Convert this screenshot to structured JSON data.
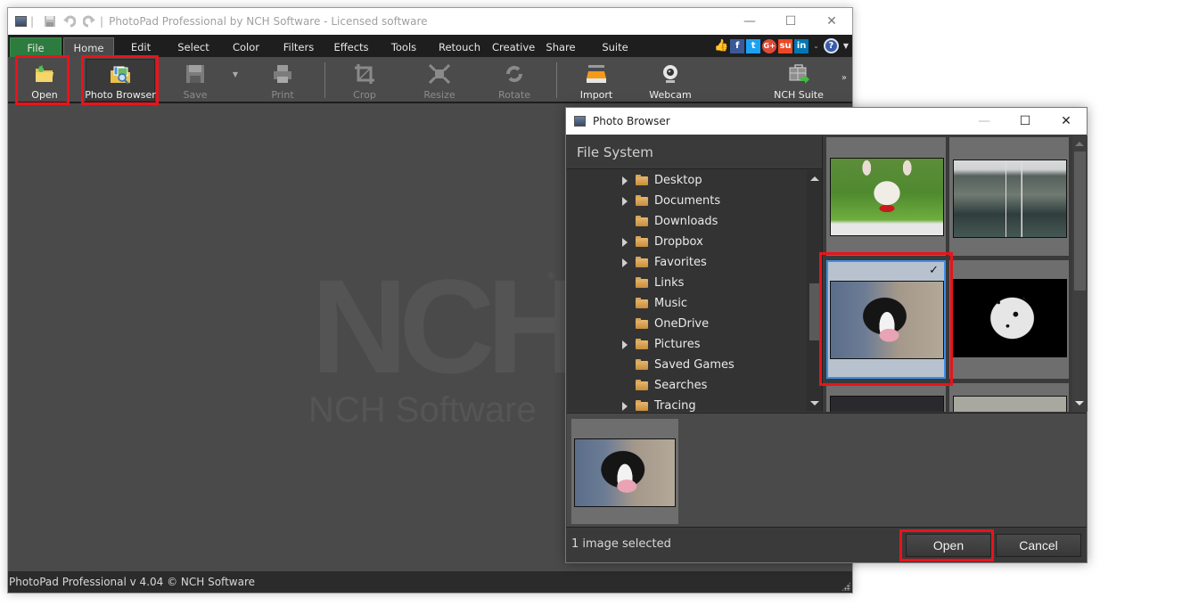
{
  "main_window": {
    "title": "PhotoPad Professional by NCH Software - Licensed software",
    "quick_access": [
      "save-icon",
      "undo-icon",
      "redo-icon"
    ],
    "window_controls": {
      "minimize": "—",
      "maximize": "☐",
      "close": "✕"
    }
  },
  "menu": {
    "items": [
      "File",
      "Home",
      "Edit",
      "Select",
      "Color",
      "Filters",
      "Effects",
      "Tools",
      "Retouch",
      "Creative",
      "Share",
      "Suite"
    ],
    "active": "Home",
    "social_icons": [
      "like-icon",
      "facebook-icon",
      "twitter-icon",
      "google-plus-icon",
      "stumbleupon-icon",
      "linkedin-icon"
    ],
    "social_glyphs": {
      "like": "👍",
      "facebook": "f",
      "twitter": "t",
      "google_plus": "G+",
      "stumbleupon": "su",
      "linkedin": "in"
    },
    "help_glyph": "?"
  },
  "toolbar": {
    "tools": [
      {
        "label": "Open",
        "icon": "open-folder-icon",
        "enabled": true,
        "highlighted": true
      },
      {
        "label": "Photo Browser",
        "icon": "photo-browser-icon",
        "enabled": true,
        "highlighted": true
      },
      {
        "label": "Save",
        "icon": "save-icon",
        "enabled": false
      },
      {
        "label": "Print",
        "icon": "print-icon",
        "enabled": false
      },
      {
        "label": "Crop",
        "icon": "crop-icon",
        "enabled": false
      },
      {
        "label": "Resize",
        "icon": "resize-icon",
        "enabled": false
      },
      {
        "label": "Rotate",
        "icon": "rotate-icon",
        "enabled": false
      },
      {
        "label": "Import",
        "icon": "import-scanner-icon",
        "enabled": true
      },
      {
        "label": "Webcam",
        "icon": "webcam-icon",
        "enabled": true
      },
      {
        "label": "NCH Suite",
        "icon": "nch-suite-icon",
        "enabled": true
      }
    ],
    "more_glyph": "»"
  },
  "canvas": {
    "watermark_logo": "NCH",
    "watermark_reg": "®",
    "watermark_text": "NCH Software"
  },
  "statusbar": {
    "text": "PhotoPad Professional v 4.04 © NCH Software"
  },
  "photo_browser": {
    "title": "Photo Browser",
    "window_controls": {
      "minimize": "—",
      "maximize": "☐",
      "close": "✕"
    },
    "file_system": {
      "header": "File System",
      "folders": [
        {
          "name": "Desktop",
          "expandable": true
        },
        {
          "name": "Documents",
          "expandable": true
        },
        {
          "name": "Downloads",
          "expandable": false
        },
        {
          "name": "Dropbox",
          "expandable": true
        },
        {
          "name": "Favorites",
          "expandable": true
        },
        {
          "name": "Links",
          "expandable": false
        },
        {
          "name": "Music",
          "expandable": false
        },
        {
          "name": "OneDrive",
          "expandable": false
        },
        {
          "name": "Pictures",
          "expandable": true
        },
        {
          "name": "Saved Games",
          "expandable": false
        },
        {
          "name": "Searches",
          "expandable": false
        },
        {
          "name": "Tracing",
          "expandable": true
        }
      ]
    },
    "thumbnails": [
      {
        "subject": "french-bulldog-photo",
        "selected": false
      },
      {
        "subject": "canyon-lake-polaroid-photo",
        "selected": false
      },
      {
        "subject": "border-collie-photo",
        "selected": true,
        "check_glyph": "✓"
      },
      {
        "subject": "dalmatian-photo",
        "selected": false
      },
      {
        "subject": "dark-dog-photo",
        "selected": false
      },
      {
        "subject": "grey-dog-photo",
        "selected": false
      }
    ],
    "selected_tray": [
      {
        "subject": "border-collie-photo"
      }
    ],
    "status": "1 image selected",
    "buttons": {
      "open": "Open",
      "cancel": "Cancel"
    }
  },
  "colors": {
    "file_tab": "#2d7b3e",
    "highlight_box": "#e8141b",
    "selection_border": "#3d8ee8",
    "menubar_bg": "#1e1e1e",
    "workspace_bg": "#4a4a4a"
  }
}
